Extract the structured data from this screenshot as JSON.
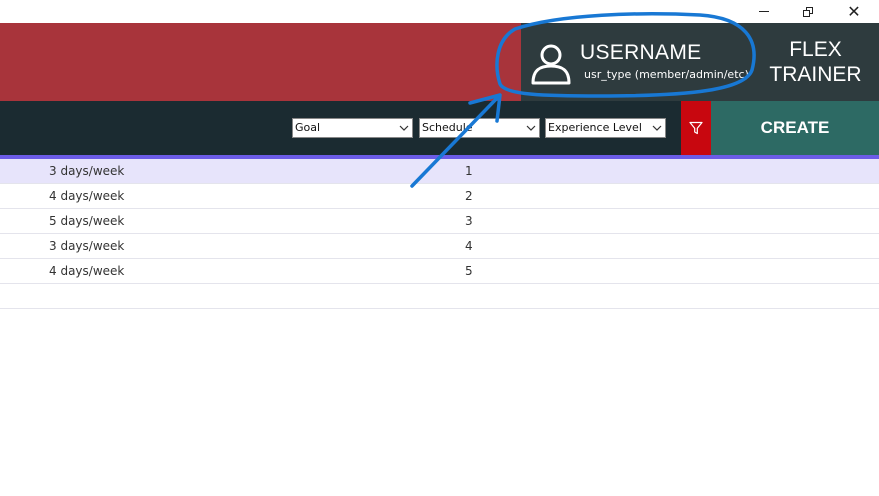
{
  "window": {
    "minimize_icon": "minimize-icon",
    "restore_icon": "restore-icon",
    "close_icon": "close-icon",
    "close_glyph": "✕"
  },
  "colors": {
    "header_red": "#a8343b",
    "panel_dark": "#2e3b3e",
    "toolbar_dark": "#1b2b31",
    "filter_red": "#c8070f",
    "create_teal": "#2d6a64",
    "accent_purple": "#6c5ce7",
    "selected_row": "#e7e4fb",
    "annotation_blue": "#1878d4"
  },
  "user": {
    "username": "USERNAME",
    "user_type": "usr_type (member/admin/etc)",
    "icon": "user-icon"
  },
  "brand": {
    "line1": "FLEX",
    "line2": "TRAINER"
  },
  "filters": {
    "goal": "Goal",
    "schedule": "Schedule",
    "experience": "Experience Level",
    "filter_icon": "filter-icon"
  },
  "actions": {
    "create_label": "CREATE"
  },
  "table": {
    "rows": [
      {
        "days": "3 days/week",
        "num": "1",
        "selected": true
      },
      {
        "days": "4 days/week",
        "num": "2"
      },
      {
        "days": "5 days/week",
        "num": "3"
      },
      {
        "days": "3 days/week",
        "num": "4"
      },
      {
        "days": "4 days/week",
        "num": "5"
      },
      {
        "days": "",
        "num": ""
      }
    ]
  }
}
